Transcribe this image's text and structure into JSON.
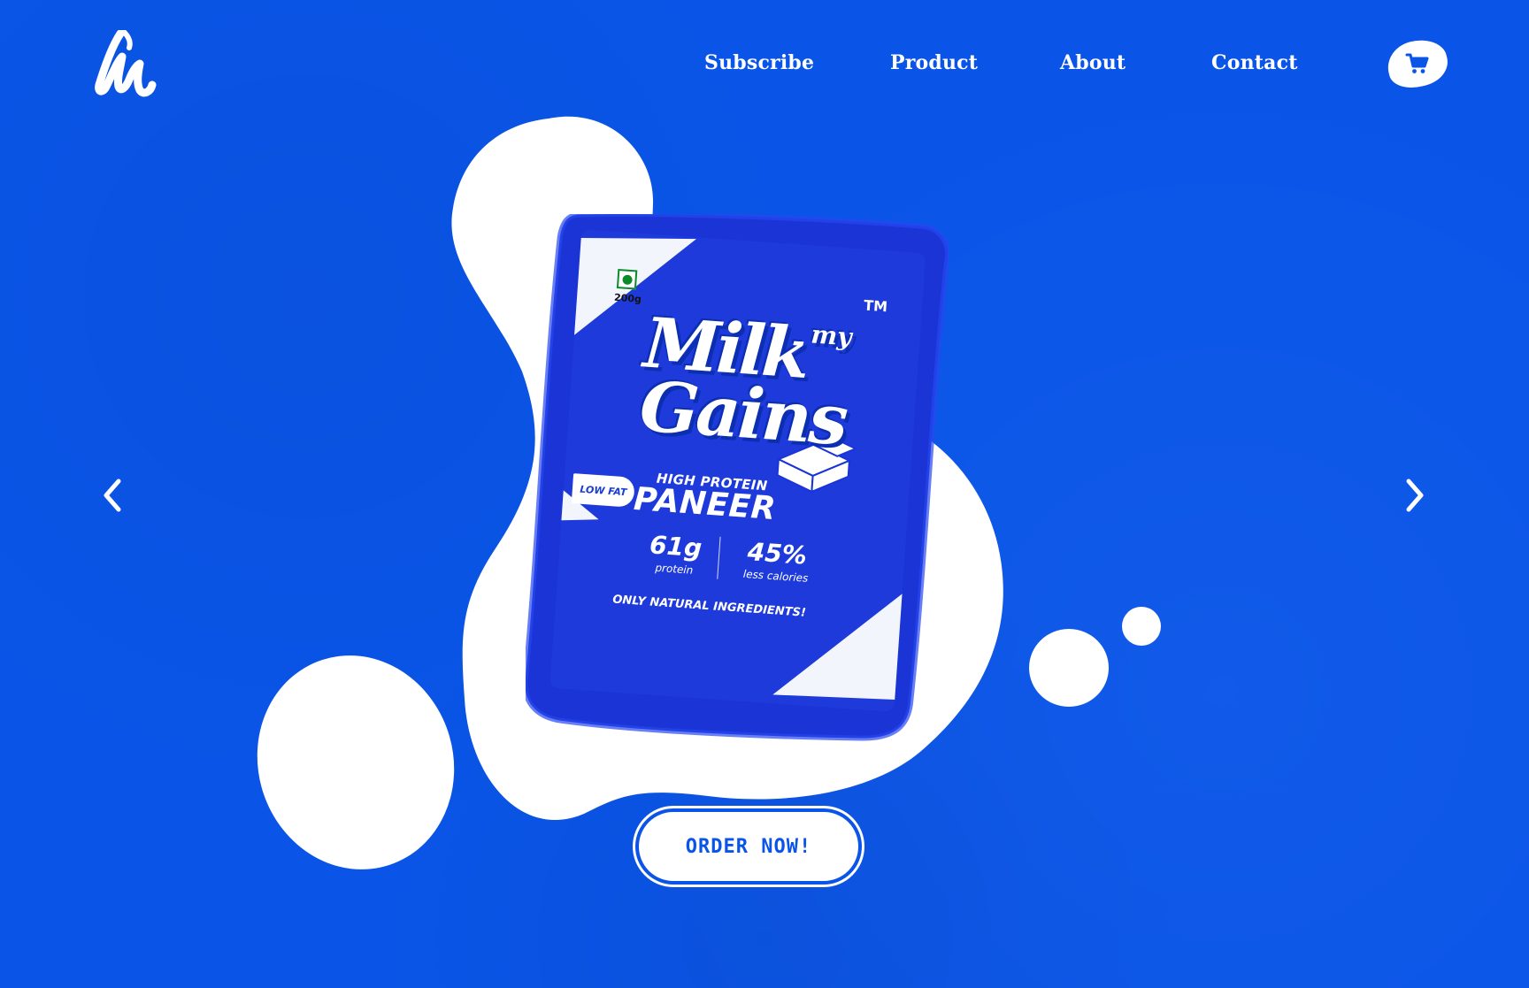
{
  "brand": {
    "logo_icon": "milk-my-gains-monogram-icon"
  },
  "nav": {
    "items": [
      {
        "label": "Subscribe"
      },
      {
        "label": "Product"
      },
      {
        "label": "About"
      },
      {
        "label": "Contact"
      }
    ],
    "cart_icon": "cart-icon"
  },
  "carousel": {
    "prev_icon": "chevron-left-icon",
    "next_icon": "chevron-right-icon"
  },
  "product": {
    "weight": "200g",
    "tm": "TM",
    "brand_line1": "Milk",
    "brand_line1_small": "my",
    "brand_line2": "Gains",
    "high_protein": "HIGH PROTEIN",
    "low_fat": "LOW FAT",
    "name": "PANEER",
    "stat1_value": "61g",
    "stat1_label": "protein",
    "stat2_value": "45%",
    "stat2_label": "less calories",
    "tagline": "ONLY NATURAL INGREDIENTS!",
    "veg_mark_icon": "veg-mark-icon"
  },
  "cta": {
    "label": "ORDER NOW!"
  },
  "colors": {
    "background": "#0a55e8",
    "pack": "#1c36d8",
    "white": "#ffffff",
    "veg_green": "#0a8a2a"
  }
}
